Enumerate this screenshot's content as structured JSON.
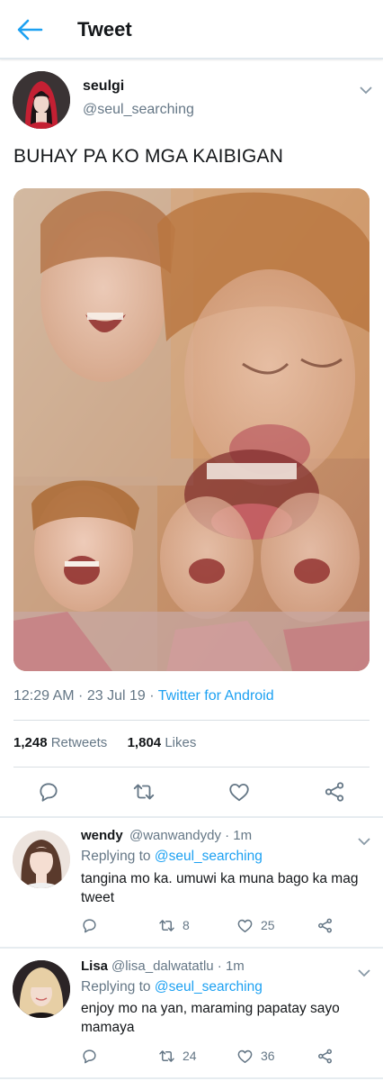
{
  "header": {
    "title": "Tweet",
    "back_icon": "arrow-left-icon",
    "accent": "#1da1f2"
  },
  "tweet": {
    "author_name": "seulgi",
    "author_handle": "@seul_searching",
    "text": "BUHAY PA KO MGA KAIBIGAN",
    "time_date": "12:29 AM · 23 Jul 19 · ",
    "source": "Twitter for Android",
    "retweets_count": "1,248",
    "retweets_label": "Retweets",
    "likes_count": "1,804",
    "likes_label": "Likes",
    "actions": [
      "reply-icon",
      "retweet-icon",
      "like-icon",
      "share-icon"
    ]
  },
  "replies": [
    {
      "name": "wendy",
      "handle": "@wanwandydy · 1m",
      "replying_prefix": "Replying to ",
      "replying_to": "@seul_searching",
      "text": "tangina mo ka. umuwi ka muna bago ka mag tweet",
      "retweets": "8",
      "likes": "25"
    },
    {
      "name": "Lisa",
      "handle": "@lisa_dalwatatlu · 1m",
      "replying_prefix": "Replying to ",
      "replying_to": "@seul_searching",
      "text": "enjoy mo na yan, maraming papatay sayo mamaya",
      "retweets": "24",
      "likes": "36"
    }
  ],
  "colors": {
    "text": "#14171a",
    "muted": "#657786",
    "link": "#1da1f2",
    "divider": "#e1e8ed"
  }
}
